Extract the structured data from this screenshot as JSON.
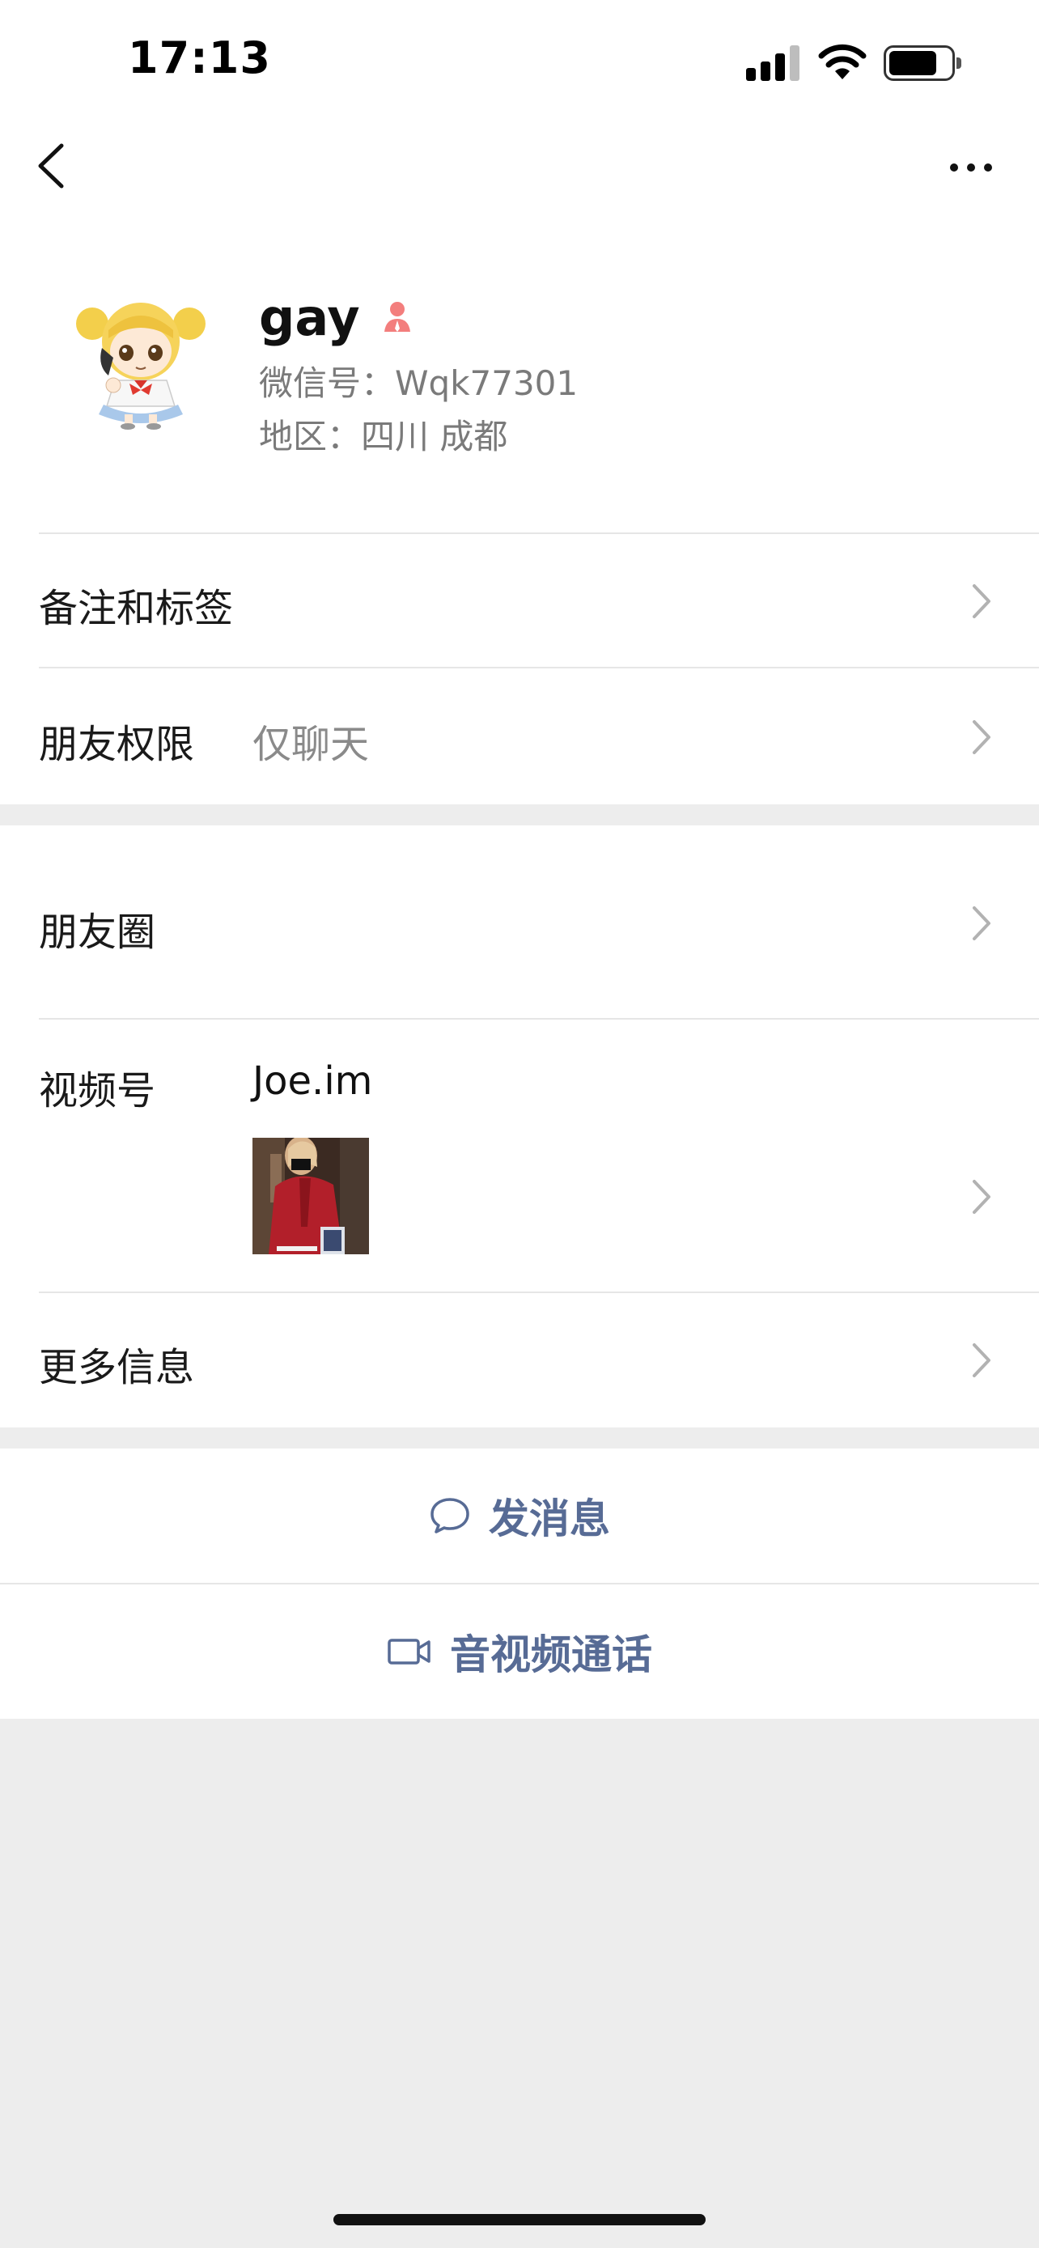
{
  "status_bar": {
    "time": "17:13"
  },
  "profile": {
    "name": "gay",
    "wechat_id": "微信号：Wqk77301",
    "region": "地区：四川 成都"
  },
  "rows": {
    "remarks_tags": "备注和标签",
    "permissions_label": "朋友权限",
    "permissions_value": "仅聊天",
    "moments": "朋友圈",
    "channels_label": "视频号",
    "channels_name": "Joe.im",
    "more_info": "更多信息"
  },
  "actions": {
    "send_message": "发消息",
    "av_call": "音视频通话"
  },
  "colors": {
    "link": "#576b95",
    "gender_female": "#f37e7d",
    "background": "#ededed"
  },
  "icons": [
    "back-icon",
    "more-icon",
    "female-icon",
    "chevron-right-icon",
    "chat-bubble-icon",
    "video-camera-icon"
  ]
}
